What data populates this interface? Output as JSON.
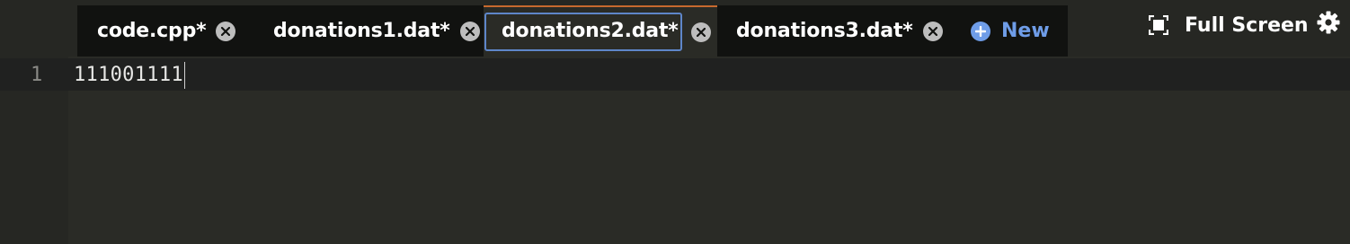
{
  "tabs": [
    {
      "label": "code.cpp*",
      "active": false
    },
    {
      "label": "donations1.dat*",
      "active": false
    },
    {
      "label": "donations2.dat*",
      "active": true
    },
    {
      "label": "donations3.dat*",
      "active": false
    }
  ],
  "toolbar": {
    "new_label": "New",
    "fullscreen_label": "Full Screen"
  },
  "editor": {
    "lines": [
      {
        "number": "1",
        "text": "111001111"
      }
    ]
  },
  "colors": {
    "background": "#262723",
    "tab_strip": "#111210",
    "active_tab_accent": "#c8692e",
    "focus_outline": "#5e86c9",
    "new_button": "#6f9de8"
  },
  "icons": {
    "close": "close-circle-icon",
    "new": "plus-circle-icon",
    "fullscreen": "fullscreen-icon",
    "settings": "gear-icon"
  }
}
